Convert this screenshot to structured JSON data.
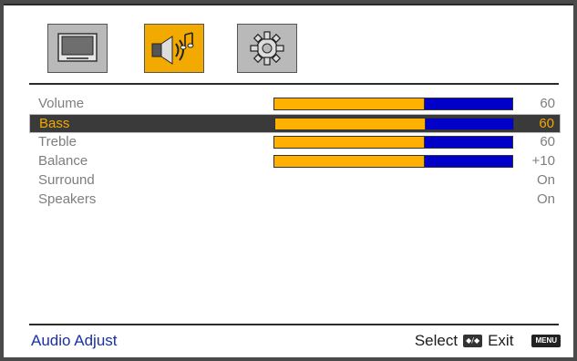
{
  "tabs": [
    {
      "icon": "tv-icon"
    },
    {
      "icon": "speaker-music-icon"
    },
    {
      "icon": "gear-icon"
    }
  ],
  "menu": {
    "items": [
      {
        "label": "Volume",
        "value": "60",
        "level": 0.63
      },
      {
        "label": "Bass",
        "value": "60",
        "level": 0.63,
        "selected": true
      },
      {
        "label": "Treble",
        "value": "60",
        "level": 0.63
      },
      {
        "label": "Balance",
        "value": "+10",
        "level": 0.63
      },
      {
        "label": "Surround",
        "value": "On"
      },
      {
        "label": "Speakers",
        "value": "On"
      }
    ]
  },
  "status": {
    "title": "Audio Adjust",
    "select_label": "Select",
    "select_key": "◆/◆",
    "exit_label": "Exit",
    "menu_key": "MENU"
  },
  "colors": {
    "accent": "#f2a900",
    "bar_fill": "#ffb000",
    "bar_bg": "#0000c8",
    "title": "#1a2fa8"
  }
}
